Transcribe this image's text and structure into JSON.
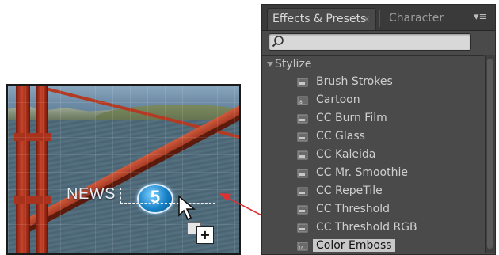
{
  "preview": {
    "news_text": "NEWS",
    "logo_number": "5"
  },
  "panel": {
    "tabs": [
      {
        "label": "Effects & Presets",
        "close": "×",
        "active": true
      },
      {
        "label": "Character",
        "active": false
      }
    ],
    "menu_glyph": "▾≡",
    "search": {
      "value": "",
      "placeholder": ""
    },
    "category": "Stylize",
    "effects": [
      {
        "label": "Brush Strokes",
        "icon": "effect-icon"
      },
      {
        "label": "Cartoon",
        "icon": "effect-icon-8bit"
      },
      {
        "label": "CC Burn Film",
        "icon": "effect-icon"
      },
      {
        "label": "CC Glass",
        "icon": "effect-icon"
      },
      {
        "label": "CC Kaleida",
        "icon": "effect-icon"
      },
      {
        "label": "CC Mr. Smoothie",
        "icon": "effect-icon"
      },
      {
        "label": "CC RepeTile",
        "icon": "effect-icon"
      },
      {
        "label": "CC Threshold",
        "icon": "effect-icon"
      },
      {
        "label": "CC Threshold RGB",
        "icon": "effect-icon"
      },
      {
        "label": "Color Emboss",
        "icon": "effect-icon-16bit",
        "selected": true
      }
    ]
  },
  "colors": {
    "arrow": "#e03030",
    "panel_bg": "#4a4a4a",
    "selection_bg": "#c8c8c8"
  },
  "drag": {
    "plus_glyph": "+"
  }
}
